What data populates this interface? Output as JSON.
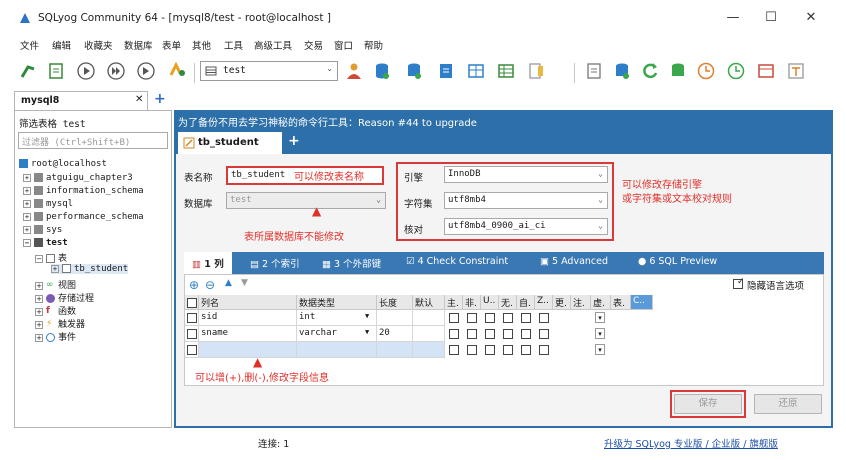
{
  "window": {
    "title": "SQLyog Community 64 - [mysql8/test - root@localhost ]",
    "minimize": "—",
    "maximize": "☐",
    "close": "✕"
  },
  "menu": [
    "文件",
    "编辑",
    "收藏夹",
    "数据库",
    "表单",
    "其他",
    "工具",
    "高级工具",
    "交易",
    "窗口",
    "帮助"
  ],
  "toolbar": {
    "db_select_value": "test",
    "icons": [
      "new-connection-icon",
      "new-query-icon",
      "execute-icon",
      "execute-all-icon",
      "stop-icon",
      "schema-icon",
      "user-icon",
      "backup-icon",
      "restore-icon",
      "import-icon",
      "schema-designer-icon",
      "query-builder-icon",
      "data-sync-icon",
      "schema-sync-icon",
      "migration-icon",
      "scheduler-icon",
      "notification-icon",
      "report-icon",
      "text-icon"
    ]
  },
  "connection_tab": {
    "label": "mysql8",
    "close": "✕",
    "add": "+"
  },
  "left_panel": {
    "filter_label": "筛选表格 test",
    "filter_placeholder": "过滤器 (Ctrl+Shift+B)",
    "tree": {
      "root": "root@localhost",
      "dbs": [
        "atguigu_chapter3",
        "information_schema",
        "mysql",
        "performance_schema",
        "sys"
      ],
      "current_db": "test",
      "tables_folder": "表",
      "table": "tb_student",
      "folders": [
        "视图",
        "存储过程",
        "函数",
        "触发器",
        "事件"
      ]
    }
  },
  "right_panel": {
    "notice": "为了备份不用去学习神秘的命令行工具：Reason #44 to upgrade",
    "doc_tab": "tb_student",
    "doc_tab_add": "+",
    "form": {
      "table_name_label": "表名称",
      "table_name_value": "tb_student",
      "database_label": "数据库",
      "database_value": "test",
      "engine_label": "引擎",
      "engine_value": "InnoDB",
      "charset_label": "字符集",
      "charset_value": "utf8mb4",
      "collation_label": "核对",
      "collation_value": "utf8mb4_0900_ai_ci"
    },
    "annotations": {
      "rename": "可以修改表名称",
      "db_readonly": "表所属数据库不能修改",
      "engine_charset": "可以修改存储引擎",
      "engine_charset_2": "或字符集或文本校对规则",
      "add_delete": "可以增(+),删(-),修改字段信息"
    },
    "sub_tabs": [
      {
        "num": "1",
        "label": "列"
      },
      {
        "num": "2",
        "label": "个索引"
      },
      {
        "num": "3",
        "label": "个外部键"
      },
      {
        "num": "4",
        "label": "Check Constraint"
      },
      {
        "num": "5",
        "label": "Advanced"
      },
      {
        "num": "6",
        "label": "SQL Preview"
      }
    ],
    "hide_lang_option": "隐藏语言选项",
    "grid": {
      "headers": [
        "列名",
        "数据类型",
        "长度",
        "默认",
        "主.",
        "非.",
        "U..",
        "无.",
        "自.",
        "Z..",
        "更.",
        "注.",
        "虚.",
        "表.",
        "C.."
      ],
      "rows": [
        {
          "name": "sid",
          "type": "int",
          "length": ""
        },
        {
          "name": "sname",
          "type": "varchar",
          "length": "20"
        },
        {
          "name": "",
          "type": "",
          "length": ""
        }
      ]
    },
    "buttons": {
      "save": "保存",
      "revert": "还原"
    }
  },
  "status": {
    "connection": "连接: 1",
    "upgrade_link": "升级为 SQLyog 专业版 / 企业版 / 旗舰版"
  },
  "colors": {
    "accent": "#2d6fa8",
    "annotation": "#e0302a"
  }
}
